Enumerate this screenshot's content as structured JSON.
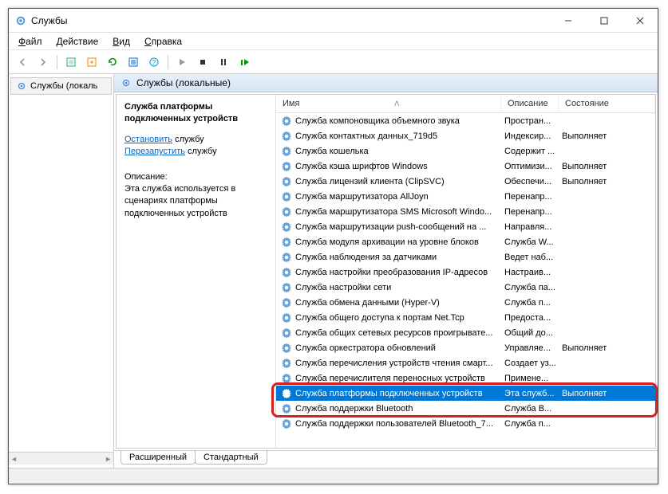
{
  "window": {
    "title": "Службы"
  },
  "menu": {
    "file": "Файл",
    "action": "Действие",
    "view": "Вид",
    "help": "Справка"
  },
  "left_pane": {
    "item": "Службы (локаль"
  },
  "right_header": {
    "title": "Службы (локальные)"
  },
  "detail": {
    "selected_name": "Служба платформы подключенных устройств",
    "stop_link": "Остановить",
    "stop_suffix": " службу",
    "restart_link": "Перезапустить",
    "restart_suffix": " службу",
    "desc_label": "Описание:",
    "desc_text": "Эта служба используется в сценариях платформы подключенных устройств"
  },
  "columns": {
    "name": "Имя",
    "desc": "Описание",
    "state": "Состояние"
  },
  "services": [
    {
      "name": "Служба компоновщика объемного звука",
      "desc": "Простран...",
      "state": ""
    },
    {
      "name": "Служба контактных данных_719d5",
      "desc": "Индексир...",
      "state": "Выполняет"
    },
    {
      "name": "Служба кошелька",
      "desc": "Содержит ...",
      "state": ""
    },
    {
      "name": "Служба кэша шрифтов Windows",
      "desc": "Оптимизи...",
      "state": "Выполняет"
    },
    {
      "name": "Служба лицензий клиента (ClipSVC)",
      "desc": "Обеспечи...",
      "state": "Выполняет"
    },
    {
      "name": "Служба маршрутизатора AllJoyn",
      "desc": "Перенапр...",
      "state": ""
    },
    {
      "name": "Служба маршрутизатора SMS Microsoft Windo...",
      "desc": "Перенапр...",
      "state": ""
    },
    {
      "name": "Служба маршрутизации push-сообщений на ...",
      "desc": "Направля...",
      "state": ""
    },
    {
      "name": "Служба модуля архивации на уровне блоков",
      "desc": "Служба W...",
      "state": ""
    },
    {
      "name": "Служба наблюдения за датчиками",
      "desc": "Ведет наб...",
      "state": ""
    },
    {
      "name": "Служба настройки преобразования IP-адресов",
      "desc": "Настраив...",
      "state": ""
    },
    {
      "name": "Служба настройки сети",
      "desc": "Служба па...",
      "state": ""
    },
    {
      "name": "Служба обмена данными (Hyper-V)",
      "desc": "Служба п...",
      "state": ""
    },
    {
      "name": "Служба общего доступа к портам Net.Tcp",
      "desc": "Предоста...",
      "state": ""
    },
    {
      "name": "Служба общих сетевых ресурсов проигрывате...",
      "desc": "Общий до...",
      "state": ""
    },
    {
      "name": "Служба оркестратора обновлений",
      "desc": "Управляе...",
      "state": "Выполняет"
    },
    {
      "name": "Служба перечисления устройств чтения смарт...",
      "desc": "Создает уз...",
      "state": ""
    },
    {
      "name": "Служба перечислителя переносных устройств",
      "desc": "Примене...",
      "state": ""
    },
    {
      "name": "Служба платформы подключенных устройств",
      "desc": "Эта служб...",
      "state": "Выполняет",
      "selected": true
    },
    {
      "name": "Служба поддержки Bluetooth",
      "desc": "Служба B...",
      "state": ""
    },
    {
      "name": "Служба поддержки пользователей Bluetooth_7...",
      "desc": "Служба п...",
      "state": ""
    }
  ],
  "tabs": {
    "extended": "Расширенный",
    "standard": "Стандартный"
  }
}
